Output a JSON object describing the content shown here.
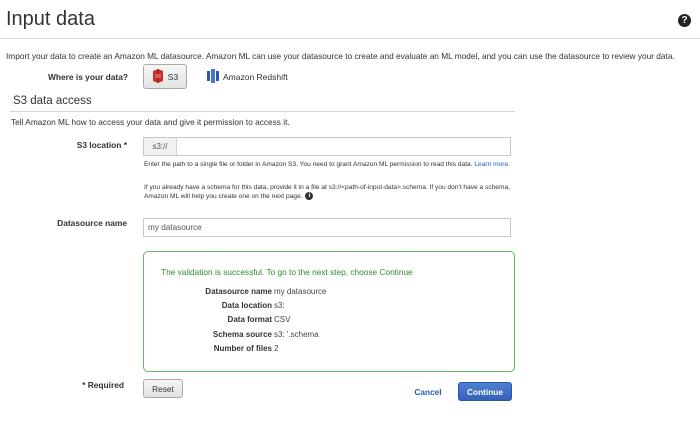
{
  "header": {
    "title": "Input data",
    "help_glyph": "?"
  },
  "intro_text": "Import your data to create an Amazon ML datasource. Amazon ML can use your datasource to create and evaluate an ML model, and you can use the datasource to review your data.",
  "source_selector": {
    "label": "Where is your data?",
    "options": [
      {
        "label": "S3",
        "icon": "s3-bucket-icon",
        "selected": true
      },
      {
        "label": "Amazon Redshift",
        "icon": "redshift-icon",
        "selected": false
      }
    ]
  },
  "s3_section": {
    "title": "S3 data access",
    "intro": "Tell Amazon ML how to access your data and give it permission to access it.",
    "location_label": "S3 location *",
    "location_prefix": "s3://",
    "location_value": "",
    "help1": "Enter the path to a single file or folder in Amazon S3. You need to grant Amazon ML permission to read this data.",
    "help1_link": "Learn more.",
    "help2": "If you already have a schema for this data, provide it in a file at s3://<path-of-input-data>.schema. If you don't have a schema, Amazon ML will help you create one on the next page.",
    "info_glyph": "i"
  },
  "datasource": {
    "label": "Datasource name",
    "value": "my datasource"
  },
  "validation": {
    "message": "The validation is successful. To go to the next step, choose Continue",
    "rows": [
      {
        "key": "Datasource name",
        "value": "my datasource"
      },
      {
        "key": "Data location",
        "value": "s3:"
      },
      {
        "key": "Data format",
        "value": "CSV"
      },
      {
        "key": "Schema source",
        "value": "s3:                              '.schema"
      },
      {
        "key": "Number of files",
        "value": "2"
      }
    ]
  },
  "footer": {
    "required_label": "*  Required",
    "reset_label": "Reset",
    "cancel_label": "Cancel",
    "continue_label": "Continue"
  },
  "colors": {
    "success_border": "#5cbf5c",
    "success_text": "#2f8a2f",
    "link": "#2461b0",
    "primary_button": "#3462b8",
    "s3_icon": "#c7302a",
    "redshift_icon": "#2e5aa8"
  }
}
